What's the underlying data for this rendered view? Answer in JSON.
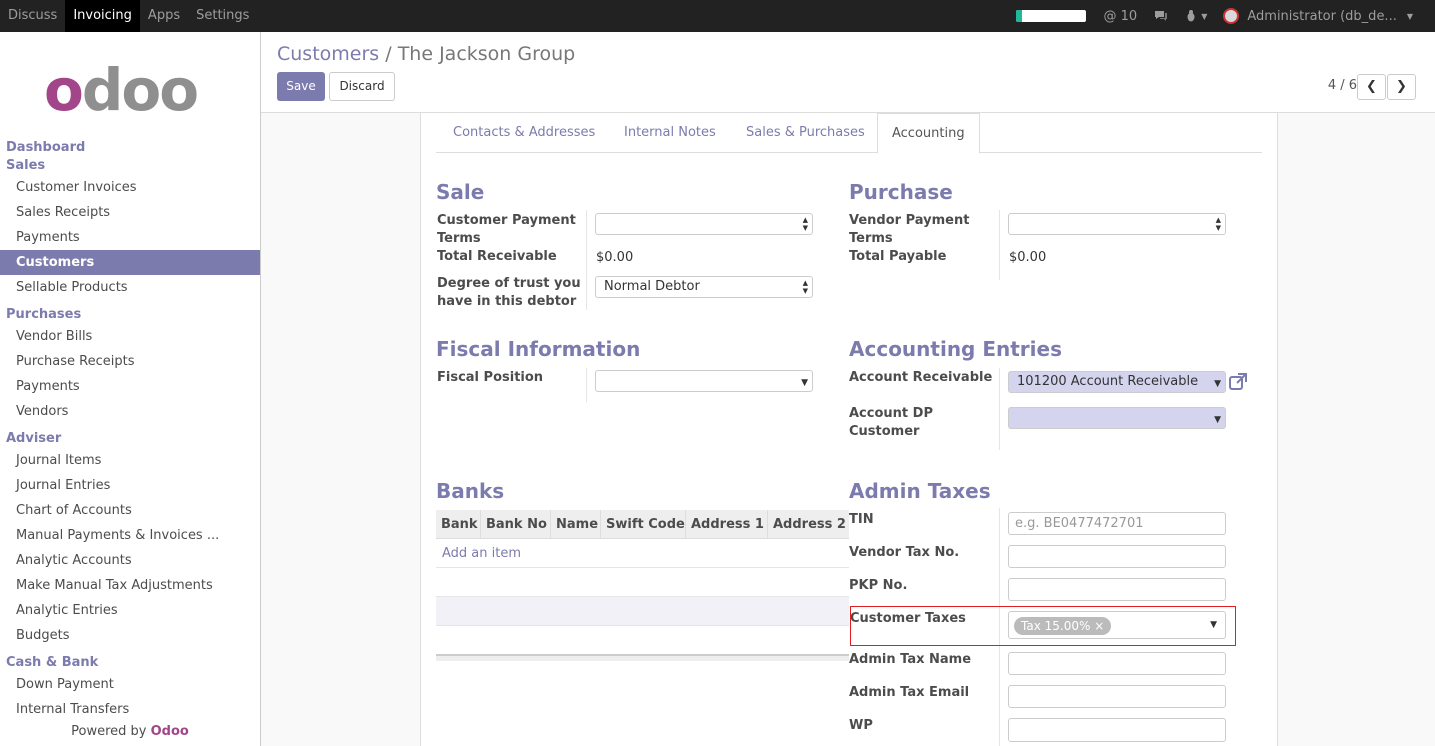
{
  "topbar": {
    "apps": [
      "Discuss",
      "Invoicing",
      "Apps",
      "Settings"
    ],
    "active_app": "Invoicing",
    "mentions": "@ 10",
    "user": "Administrator (db_de..."
  },
  "sidebar": {
    "sections": [
      {
        "title": "Dashboard",
        "items": []
      },
      {
        "title": "Sales",
        "items": [
          "Customer Invoices",
          "Sales Receipts",
          "Payments",
          "Customers",
          "Sellable Products"
        ]
      },
      {
        "title": "Purchases",
        "items": [
          "Vendor Bills",
          "Purchase Receipts",
          "Payments",
          "Vendors"
        ]
      },
      {
        "title": "Adviser",
        "items": [
          "Journal Items",
          "Journal Entries",
          "Chart of Accounts",
          "Manual Payments & Invoices ...",
          "Analytic Accounts",
          "Make Manual Tax Adjustments",
          "Analytic Entries",
          "Budgets"
        ]
      },
      {
        "title": "Cash & Bank",
        "items": [
          "Down Payment",
          "Internal Transfers"
        ]
      }
    ],
    "active_item": "Customers",
    "powered_prefix": "Powered by",
    "powered_brand": "Odoo"
  },
  "breadcrumb": {
    "parent": "Customers",
    "sep": "/",
    "current": "The Jackson Group"
  },
  "buttons": {
    "save": "Save",
    "discard": "Discard"
  },
  "pager": {
    "text": "4 / 6",
    "prev": "❮",
    "next": "❯"
  },
  "tabs": [
    "Contacts & Addresses",
    "Internal Notes",
    "Sales & Purchases",
    "Accounting"
  ],
  "sale": {
    "heading": "Sale",
    "payment_terms_label_1": "Customer Payment",
    "payment_terms_label_2": "Terms",
    "total_receivable_label": "Total Receivable",
    "total_receivable": "$0.00",
    "trust_label_1": "Degree of trust you",
    "trust_label_2": "have in this debtor",
    "trust_value": "Normal Debtor"
  },
  "purchase": {
    "heading": "Purchase",
    "payment_terms_label_1": "Vendor Payment",
    "payment_terms_label_2": "Terms",
    "total_payable_label": "Total Payable",
    "total_payable": "$0.00"
  },
  "fiscal": {
    "heading": "Fiscal Information",
    "position_label": "Fiscal Position"
  },
  "accounting_entries": {
    "heading": "Accounting Entries",
    "receivable_label": "Account Receivable",
    "receivable_value": "101200 Account Receivable",
    "dp_label_1": "Account DP",
    "dp_label_2": "Customer"
  },
  "banks": {
    "heading": "Banks",
    "columns": [
      "Bank",
      "Bank No",
      "Name",
      "Swift Code",
      "Address 1",
      "Address 2"
    ],
    "add_item": "Add an item"
  },
  "admin_taxes": {
    "heading": "Admin Taxes",
    "tin_label": "TIN",
    "tin_placeholder": "e.g. BE0477472701",
    "vendor_tax_label": "Vendor Tax No.",
    "pkp_label": "PKP No.",
    "customer_taxes_label": "Customer Taxes",
    "customer_tax_tag": "Tax 15.00%",
    "admin_tax_name_label": "Admin Tax Name",
    "admin_tax_email_label": "Admin Tax Email",
    "wp_label": "WP"
  }
}
